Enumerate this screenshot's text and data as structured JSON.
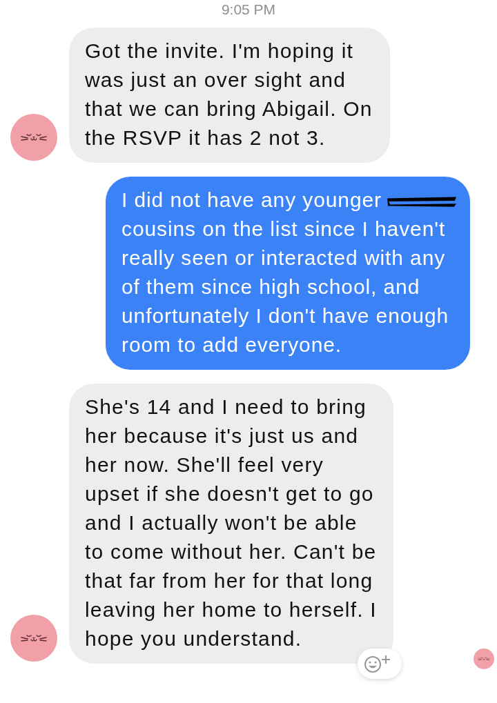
{
  "timestamp": "9:05 PM",
  "messages": [
    {
      "kind": "received",
      "text": "Got the invite. I'm hoping it was just an over sight and that we can bring Abigail. On the RSVP it has 2 not 3.",
      "avatar": true,
      "redacted": false
    },
    {
      "kind": "sent",
      "text": "I did not have any younger cousins on the list since I haven't really seen or interacted with any of them since high school, and unfortunately I don't have enough room to add everyone.",
      "redacted": true
    },
    {
      "kind": "received",
      "text": "She's 14 and I need to bring her because it's just us and her now. She'll feel very upset if she doesn't get to go and I actually won't be able to come without her. Can't be that far from her for that long leaving her home to herself. I hope you understand.",
      "avatar": true,
      "redacted": false,
      "reaction_button": true
    }
  ],
  "read_receipt": true
}
